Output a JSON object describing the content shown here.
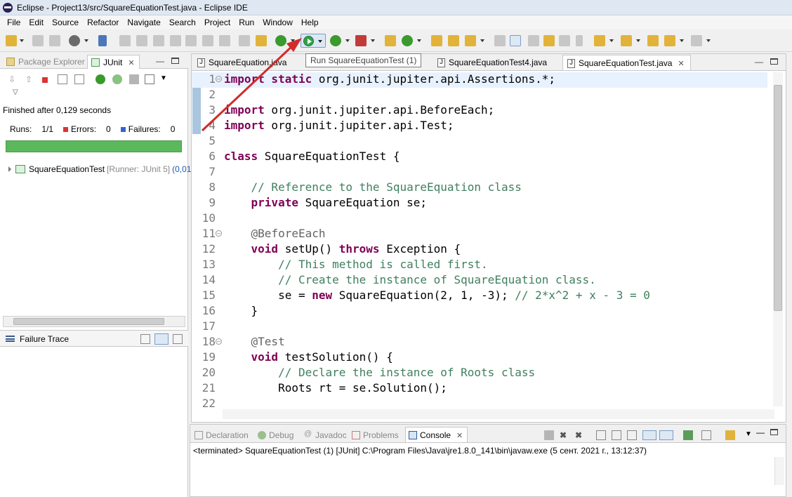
{
  "window": {
    "title": "Eclipse - Project13/src/SquareEquationTest.java - Eclipse IDE"
  },
  "menu": [
    "File",
    "Edit",
    "Source",
    "Refactor",
    "Navigate",
    "Search",
    "Project",
    "Run",
    "Window",
    "Help"
  ],
  "tooltip": "Run SquareEquationTest (1)",
  "left_panel": {
    "tabs": [
      {
        "label": "Package Explorer",
        "active": false
      },
      {
        "label": "JUnit",
        "active": true
      }
    ],
    "finished": "Finished after 0,129 seconds",
    "runs_label": "Runs:",
    "runs_value": "1/1",
    "errors_label": "Errors:",
    "errors_value": "0",
    "failures_label": "Failures:",
    "failures_value": "0",
    "progress_fraction": 1.0,
    "progress_color": "#5cb85c",
    "tree_item": {
      "name": "SquareEquationTest",
      "runner": "[Runner: JUnit 5]",
      "time": "(0,01"
    },
    "failure_trace": "Failure Trace"
  },
  "editor": {
    "tabs": [
      {
        "label": "SquareEquation.java",
        "active": false
      },
      {
        "label": "SquareEquationTest4.java",
        "active": false
      },
      {
        "label": "SquareEquationTest.java",
        "active": true
      }
    ],
    "lines": [
      {
        "n": "1",
        "fold": true,
        "segs": [
          [
            "kw",
            "import static"
          ],
          [
            "",
            "org.junit.jupiter.api.Assertions.*;"
          ]
        ]
      },
      {
        "n": "2",
        "segs": []
      },
      {
        "n": "3",
        "segs": [
          [
            "kw",
            "import"
          ],
          [
            "",
            "org.junit.jupiter.api.BeforeEach;"
          ]
        ]
      },
      {
        "n": "4",
        "segs": [
          [
            "kw",
            "import"
          ],
          [
            "",
            "org.junit.jupiter.api.Test;"
          ]
        ]
      },
      {
        "n": "5",
        "segs": []
      },
      {
        "n": "6",
        "segs": [
          [
            "kw",
            "class"
          ],
          [
            "",
            "SquareEquationTest {"
          ]
        ]
      },
      {
        "n": "7",
        "segs": []
      },
      {
        "n": "8",
        "segs": [
          [
            "",
            "    "
          ],
          [
            "cm",
            "// Reference to the SquareEquation class"
          ]
        ]
      },
      {
        "n": "9",
        "segs": [
          [
            "",
            "    "
          ],
          [
            "kw",
            "private"
          ],
          [
            "",
            "SquareEquation se;"
          ]
        ]
      },
      {
        "n": "10",
        "segs": []
      },
      {
        "n": "11",
        "fold": true,
        "segs": [
          [
            "",
            "    "
          ],
          [
            "an",
            "@BeforeEach"
          ]
        ]
      },
      {
        "n": "12",
        "segs": [
          [
            "",
            "    "
          ],
          [
            "kw",
            "void"
          ],
          [
            "",
            " setUp() "
          ],
          [
            "kw",
            "throws"
          ],
          [
            "",
            " Exception {"
          ]
        ]
      },
      {
        "n": "13",
        "segs": [
          [
            "",
            "        "
          ],
          [
            "cm",
            "// This method is called first."
          ]
        ]
      },
      {
        "n": "14",
        "segs": [
          [
            "",
            "        "
          ],
          [
            "cm",
            "// Create the instance of SquareEquation class."
          ]
        ]
      },
      {
        "n": "15",
        "segs": [
          [
            "",
            "        se = "
          ],
          [
            "kw",
            "new"
          ],
          [
            "",
            " SquareEquation(2, 1, -3); "
          ],
          [
            "cm",
            "// 2*x^2 + x - 3 = 0"
          ]
        ]
      },
      {
        "n": "16",
        "segs": [
          [
            "",
            "    }"
          ]
        ]
      },
      {
        "n": "17",
        "segs": []
      },
      {
        "n": "18",
        "fold": true,
        "segs": [
          [
            "",
            "    "
          ],
          [
            "an",
            "@Test"
          ]
        ]
      },
      {
        "n": "19",
        "segs": [
          [
            "",
            "    "
          ],
          [
            "kw",
            "void"
          ],
          [
            "",
            " testSolution() {"
          ]
        ]
      },
      {
        "n": "20",
        "segs": [
          [
            "",
            "        "
          ],
          [
            "cm",
            "// Declare the instance of Roots class"
          ]
        ]
      },
      {
        "n": "21",
        "segs": [
          [
            "",
            "        Roots rt = se.Solution();"
          ]
        ]
      },
      {
        "n": "22",
        "segs": []
      }
    ]
  },
  "console": {
    "tabs": [
      {
        "label": "Declaration",
        "active": false
      },
      {
        "label": "Debug",
        "active": false
      },
      {
        "label": "Javadoc",
        "active": false
      },
      {
        "label": "Problems",
        "active": false
      },
      {
        "label": "Console",
        "active": true
      }
    ],
    "line": "<terminated> SquareEquationTest (1) [JUnit] C:\\Program Files\\Java\\jre1.8.0_141\\bin\\javaw.exe (5 сент. 2021 г., 13:12:37)"
  },
  "colors": {
    "arrow": "#d12b2b",
    "keyword": "#7f0055",
    "comment": "#3f7f5f"
  }
}
